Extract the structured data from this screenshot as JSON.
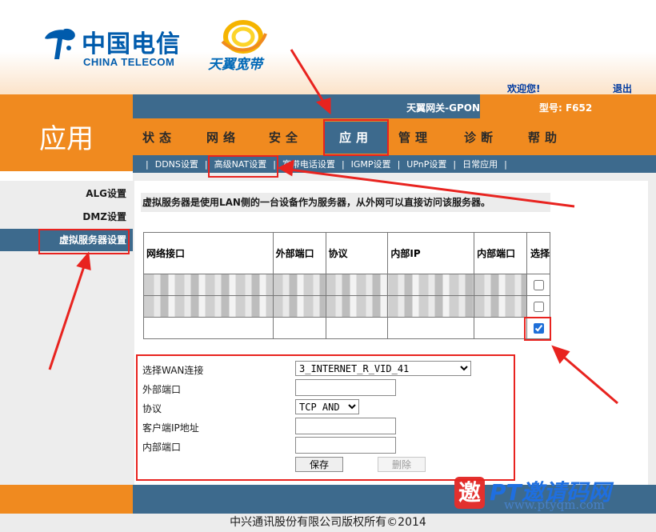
{
  "header": {
    "brand_cn": "中国电信",
    "brand_en": "CHINA TELECOM",
    "sub_brand": "天翼宽带",
    "welcome": "欢迎您!",
    "logout": "退出",
    "brand_color": "#005bac"
  },
  "app_title": "应用",
  "gateway_title": "天翼网关-GPON",
  "model": "型号: F652",
  "nav": {
    "tabs": [
      {
        "label": "状态"
      },
      {
        "label": "网络"
      },
      {
        "label": "安全"
      },
      {
        "label": "应用",
        "active": true
      },
      {
        "label": "管理"
      },
      {
        "label": "诊断"
      },
      {
        "label": "帮助"
      }
    ]
  },
  "subnav": {
    "items": [
      {
        "label": "DDNS设置"
      },
      {
        "label": "高级NAT设置",
        "active": true
      },
      {
        "label": "宽带电话设置"
      },
      {
        "label": "IGMP设置"
      },
      {
        "label": "UPnP设置"
      },
      {
        "label": "日常应用"
      }
    ]
  },
  "sidebar": {
    "items": [
      {
        "label": "ALG设置"
      },
      {
        "label": "DMZ设置"
      },
      {
        "label": "虚拟服务器设置",
        "active": true
      }
    ]
  },
  "description": "虚拟服务器是使用LAN侧的一台设备作为服务器，从外网可以直接访问该服务器。",
  "table": {
    "headers": [
      "网络接口",
      "外部端口",
      "协议",
      "内部IP",
      "内部端口",
      "选择"
    ],
    "rows": [
      {
        "checked": false,
        "redacted": true
      },
      {
        "checked": false,
        "redacted": true
      },
      {
        "checked": true,
        "redacted": false
      }
    ]
  },
  "form": {
    "wan_label": "选择WAN连接",
    "wan_value": "3_INTERNET_R_VID_41",
    "ext_port_label": "外部端口",
    "ext_port_value": "",
    "protocol_label": "协议",
    "protocol_value": "TCP AND",
    "client_ip_label": "客户端IP地址",
    "client_ip_value": "",
    "int_port_label": "内部端口",
    "int_port_value": "",
    "save_label": "保存",
    "delete_label": "删除"
  },
  "footer": "中兴通讯股份有限公司版权所有©2014",
  "watermark": {
    "seal": "邀",
    "name": "PT邀请码网",
    "url": "www.ptyqm.com"
  },
  "colors": {
    "orange": "#f08a1f",
    "steel_blue": "#3d6a8d",
    "annotation_red": "#e8231f"
  }
}
